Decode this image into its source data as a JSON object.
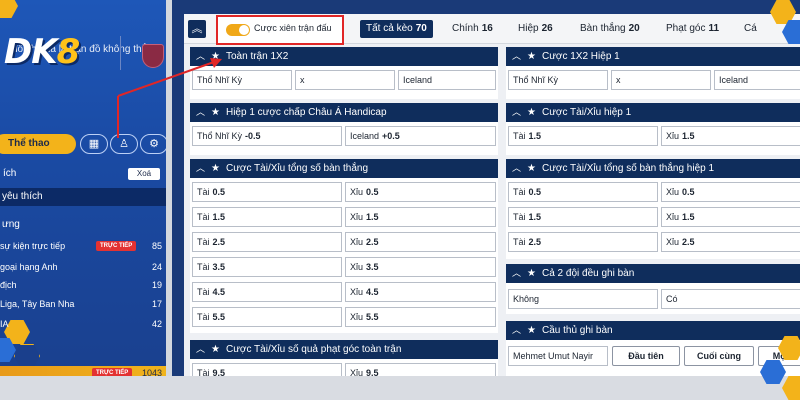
{
  "sidebar": {
    "logo_prefix": "DK",
    "logo_suffix": "8",
    "hero_text": "đối thủ đã là trận đồ không thắng",
    "sport_button": "Thể thao",
    "favorites_head": "ích",
    "clear_button": "Xoá",
    "favorite_item": "yêu thích",
    "group_head": "ưng",
    "leagues": [
      {
        "name": "sự kiện trực tiếp",
        "badge": "TRỰC TIẾP",
        "count": "85"
      },
      {
        "name": "goại hạng Anh",
        "badge": "",
        "count": "24"
      },
      {
        "name": "địch",
        "badge": "",
        "count": "19"
      },
      {
        "name": "Liga, Tây Ban Nha",
        "badge": "",
        "count": "17"
      },
      {
        "name": "IA",
        "badge": "",
        "count": "42"
      }
    ],
    "bottom_badge": "TRỰC TIẾP",
    "bottom_count": "1043"
  },
  "topbar": {
    "toggle_label": "Cược xiên trận đấu",
    "tabs": [
      {
        "label": "Tất cả kèo",
        "count": "70"
      },
      {
        "label": "Chính",
        "count": "16"
      },
      {
        "label": "Hiệp",
        "count": "26"
      },
      {
        "label": "Bàn thắng",
        "count": "20"
      },
      {
        "label": "Phạt góc",
        "count": "11"
      },
      {
        "label": "Cá",
        "count": ""
      }
    ]
  },
  "panels": {
    "p1": {
      "title": "Toàn trận 1X2",
      "cells": [
        "Thổ Nhĩ Kỳ",
        "x",
        "Iceland"
      ]
    },
    "p2": {
      "title": "Cược 1X2 Hiệp 1",
      "cells": [
        "Thổ Nhĩ Kỳ",
        "x",
        "Iceland"
      ]
    },
    "p3": {
      "title": "Hiệp 1 cược chấp Châu Á Handicap",
      "cells": [
        {
          "label": "Thổ Nhĩ Kỳ",
          "val": "-0.5"
        },
        {
          "label": "Iceland",
          "val": "+0.5"
        }
      ]
    },
    "p4": {
      "title": "Cược Tài/Xỉu hiệp 1",
      "cells": [
        {
          "label": "Tài",
          "val": "1.5"
        },
        {
          "label": "Xỉu",
          "val": "1.5"
        }
      ]
    },
    "p5": {
      "title": "Cược Tài/Xỉu tổng số bàn thắng",
      "rows": [
        [
          "0.5",
          "0.5"
        ],
        [
          "1.5",
          "1.5"
        ],
        [
          "2.5",
          "2.5"
        ],
        [
          "3.5",
          "3.5"
        ],
        [
          "4.5",
          "4.5"
        ],
        [
          "5.5",
          "5.5"
        ]
      ],
      "over": "Tài",
      "under": "Xỉu"
    },
    "p6": {
      "title": "Cược Tài/Xỉu tổng số bàn thắng hiệp 1",
      "rows": [
        [
          "0.5",
          "0.5"
        ],
        [
          "1.5",
          "1.5"
        ],
        [
          "2.5",
          "2.5"
        ]
      ],
      "over": "Tài",
      "under": "Xỉu"
    },
    "p7": {
      "title": "Cả 2 đội đều ghi bàn",
      "cells": [
        "Không",
        "Có"
      ]
    },
    "p8": {
      "title": "Cầu thủ ghi bàn",
      "player": "Mehmet Umut Nayir",
      "buttons": [
        "Đầu tiên",
        "Cuối cùng",
        "Mọi l"
      ]
    },
    "p9": {
      "title": "Cược Tài/Xỉu số quả phạt góc toàn trận",
      "row": {
        "over": "Tài",
        "over_val": "9.5",
        "under": "Xỉu",
        "under_val": "9.5"
      }
    }
  },
  "colors": {
    "navy": "#0f2d5c",
    "accent": "#f0a818",
    "highlight": "#e12626"
  }
}
